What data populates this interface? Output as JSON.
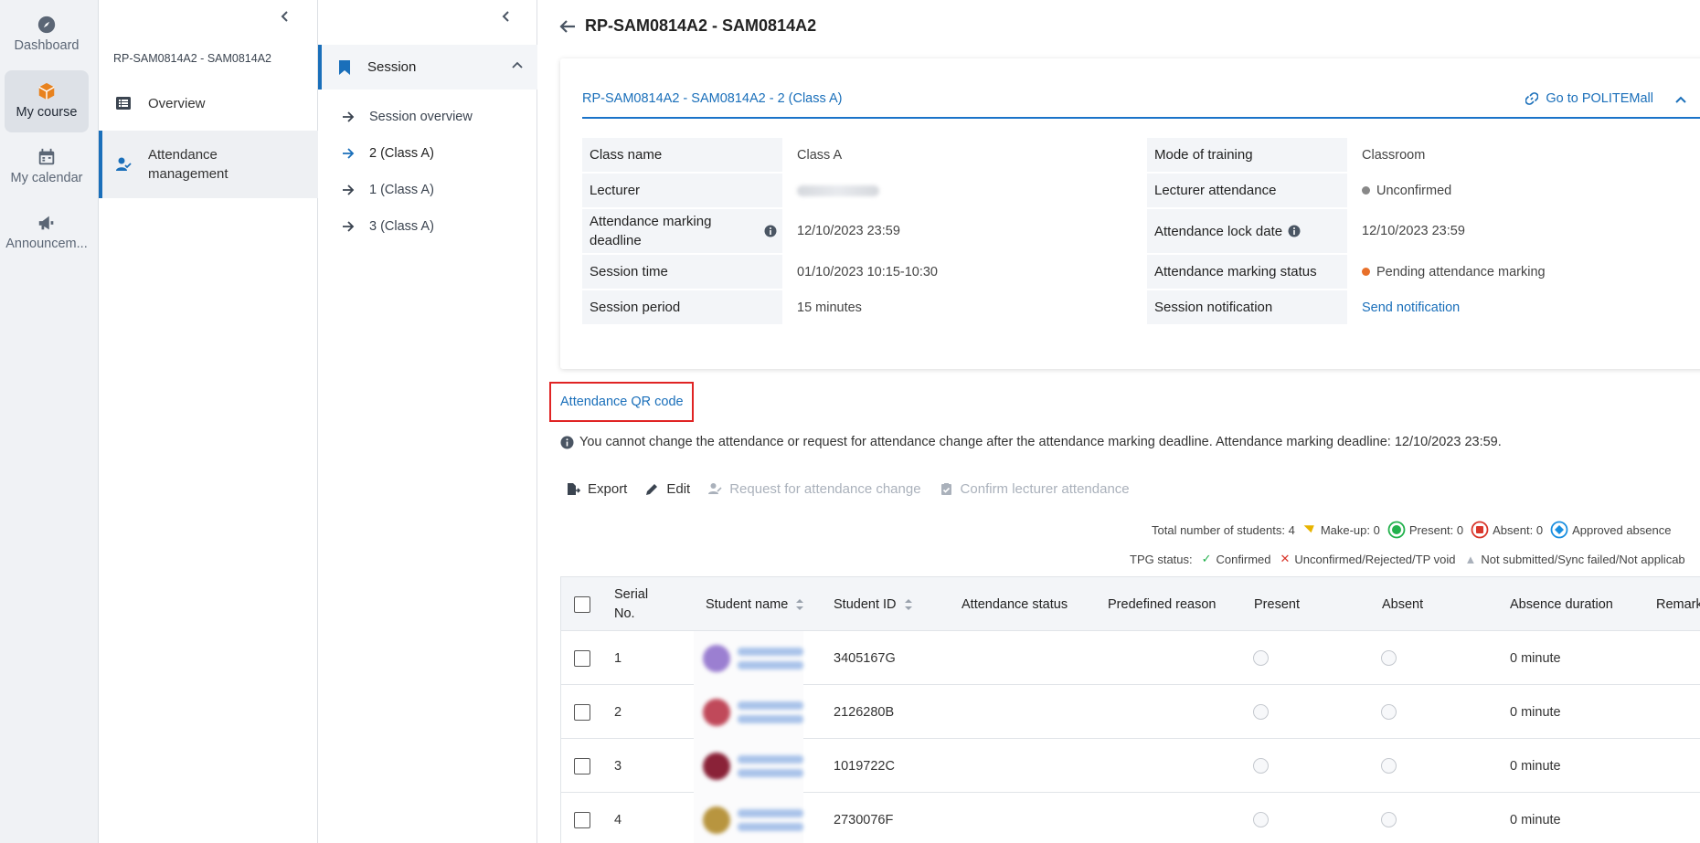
{
  "rail": {
    "items": [
      {
        "label": "Dashboard",
        "icon": "compass-icon"
      },
      {
        "label": "My course",
        "icon": "cube-icon"
      },
      {
        "label": "My calendar",
        "icon": "calendar-icon"
      },
      {
        "label": "Announcem...",
        "icon": "megaphone-icon"
      }
    ]
  },
  "course_nav": {
    "course_code": "RP-SAM0814A2 - SAM0814A2",
    "items": [
      {
        "label": "Overview",
        "icon": "list-icon"
      },
      {
        "label": "Attendance management",
        "icon": "user-check-icon"
      }
    ]
  },
  "session_nav": {
    "header": "Session",
    "items": [
      {
        "label": "Session overview"
      },
      {
        "label": "2 (Class A)"
      },
      {
        "label": "1 (Class A)"
      },
      {
        "label": "3 (Class A)"
      }
    ]
  },
  "main": {
    "title": "RP-SAM0814A2 - SAM0814A2",
    "card": {
      "code": "RP-SAM0814A2 - SAM0814A2 - 2 (Class A)",
      "goto_label": "Go to POLITEMall",
      "left": [
        {
          "label": "Class name",
          "value": "Class A"
        },
        {
          "label": "Lecturer",
          "value": ""
        },
        {
          "label": "Attendance marking deadline",
          "value": "12/10/2023 23:59"
        },
        {
          "label": "Session time",
          "value": "01/10/2023 10:15-10:30"
        },
        {
          "label": "Session period",
          "value": "15 minutes"
        }
      ],
      "right": [
        {
          "label": "Mode of training",
          "value": "Classroom"
        },
        {
          "label": "Lecturer attendance",
          "value": "Unconfirmed"
        },
        {
          "label": "Attendance lock date",
          "value": "12/10/2023 23:59"
        },
        {
          "label": "Attendance marking status",
          "value": "Pending attendance marking"
        },
        {
          "label": "Session notification",
          "value": "Send notification"
        }
      ]
    },
    "qr_button": "Attendance QR code",
    "notice": "You cannot change the attendance or request for attendance change after the attendance marking deadline. Attendance marking deadline: 12/10/2023 23:59.",
    "toolbar": {
      "export": "Export",
      "edit": "Edit",
      "request_change": "Request for attendance change",
      "confirm_lecturer": "Confirm lecturer attendance"
    },
    "summary": {
      "total": "Total number of students: 4",
      "makeup": "Make-up: 0",
      "present": "Present: 0",
      "absent": "Absent: 0",
      "approved": "Approved absence"
    },
    "tpg": {
      "label": "TPG status:",
      "confirmed": "Confirmed",
      "unconfirmed": "Unconfirmed/Rejected/TP void",
      "not_submitted": "Not submitted/Sync failed/Not applicab"
    },
    "table": {
      "headers": {
        "serial": "Serial No.",
        "name": "Student name",
        "id": "Student ID",
        "status": "Attendance status",
        "reason": "Predefined reason",
        "present": "Present",
        "absent": "Absent",
        "duration": "Absence duration",
        "remark": "Remark"
      },
      "rows": [
        {
          "serial": "1",
          "id": "3405167G",
          "duration": "0 minute",
          "avatar_color": "#9b7fd1"
        },
        {
          "serial": "2",
          "id": "2126280B",
          "duration": "0 minute",
          "avatar_color": "#c0495a"
        },
        {
          "serial": "3",
          "id": "1019722C",
          "duration": "0 minute",
          "avatar_color": "#8a2238"
        },
        {
          "serial": "4",
          "id": "2730076F",
          "duration": "0 minute",
          "avatar_color": "#b8953f"
        }
      ]
    }
  },
  "colors": {
    "accent": "#1a6fba",
    "qr_border": "#e02424",
    "pending_dot": "#e8702a",
    "unconfirmed_dot": "#888888",
    "present_green": "#22b14c",
    "absent_red": "#d9362b",
    "approved_blue": "#1a8fe0",
    "makeup_yellow": "#e8b400"
  }
}
